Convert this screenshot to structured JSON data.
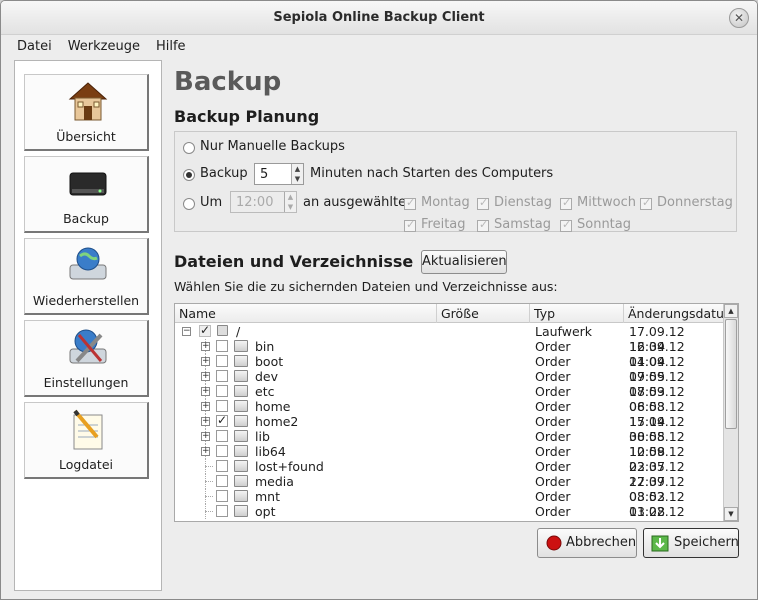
{
  "window": {
    "title": "Sepiola Online Backup Client",
    "close_glyph": "✕"
  },
  "menu": [
    "Datei",
    "Werkzeuge",
    "Hilfe"
  ],
  "sidebar": {
    "items": [
      {
        "label": "Übersicht",
        "icon": "house-icon"
      },
      {
        "label": "Backup",
        "icon": "harddrive-icon"
      },
      {
        "label": "Wiederherstellen",
        "icon": "restore-drive-globe-icon"
      },
      {
        "label": "Einstellungen",
        "icon": "settings-tools-icon"
      },
      {
        "label": "Logdatei",
        "icon": "notepad-pencil-icon"
      }
    ]
  },
  "main": {
    "title": "Backup",
    "planning": {
      "title": "Backup Planung",
      "opt_manual": "Nur Manuelle Backups",
      "opt_backup": "Backup",
      "minutes_value": "5",
      "minutes_suffix": "Minuten nach Starten des Computers",
      "opt_at": "Um",
      "time_value": "12:00",
      "days_prefix": "an ausgewählte",
      "days": [
        "Montag",
        "Dienstag",
        "Mittwoch",
        "Donnerstag",
        "Freitag",
        "Samstag",
        "Sonntag"
      ],
      "selected": "backup"
    },
    "files": {
      "title": "Dateien und Verzeichnisse",
      "refresh": "Aktualisieren",
      "hint": "Wählen Sie die zu sichernden Dateien und Verzeichnisse aus:",
      "columns": [
        "Name",
        "Größe",
        "Typ",
        "Änderungsdatu"
      ],
      "root": {
        "name": "/",
        "type": "Laufwerk",
        "date": "17.09.12 16:34"
      },
      "rows": [
        {
          "name": "bin",
          "type": "Order",
          "date": "12.09.12 11:04",
          "expandable": true,
          "checked": false
        },
        {
          "name": "boot",
          "type": "Order",
          "date": "04.09.12 09:55",
          "expandable": true,
          "checked": false
        },
        {
          "name": "dev",
          "type": "Order",
          "date": "17.09.12 08:53",
          "expandable": true,
          "checked": false
        },
        {
          "name": "etc",
          "type": "Order",
          "date": "17.09.12 08:53",
          "expandable": true,
          "checked": false
        },
        {
          "name": "home",
          "type": "Order",
          "date": "06.08.12 15:14",
          "expandable": true,
          "checked": false
        },
        {
          "name": "home2",
          "type": "Order",
          "date": "17.09.12 08:55",
          "expandable": true,
          "checked": true
        },
        {
          "name": "lib",
          "type": "Order",
          "date": "30.08.12 10:58",
          "expandable": true,
          "checked": false
        },
        {
          "name": "lib64",
          "type": "Order",
          "date": "12.09.12 03:37",
          "expandable": true,
          "checked": false
        },
        {
          "name": "lost+found",
          "type": "Order",
          "date": "22.05.12 22:37",
          "expandable": false,
          "checked": false
        },
        {
          "name": "media",
          "type": "Order",
          "date": "17.09.12 08:53",
          "expandable": false,
          "checked": false
        },
        {
          "name": "mnt",
          "type": "Order",
          "date": "03.02.12 11:28",
          "expandable": false,
          "checked": false
        },
        {
          "name": "opt",
          "type": "Order",
          "date": "03.02.12 11:28",
          "expandable": false,
          "checked": false
        }
      ]
    },
    "actions": {
      "cancel": "Abbrechen",
      "save": "Speichern"
    }
  },
  "colors": {
    "accent_red": "#cc1111",
    "save_green": "#3a9a2a"
  }
}
